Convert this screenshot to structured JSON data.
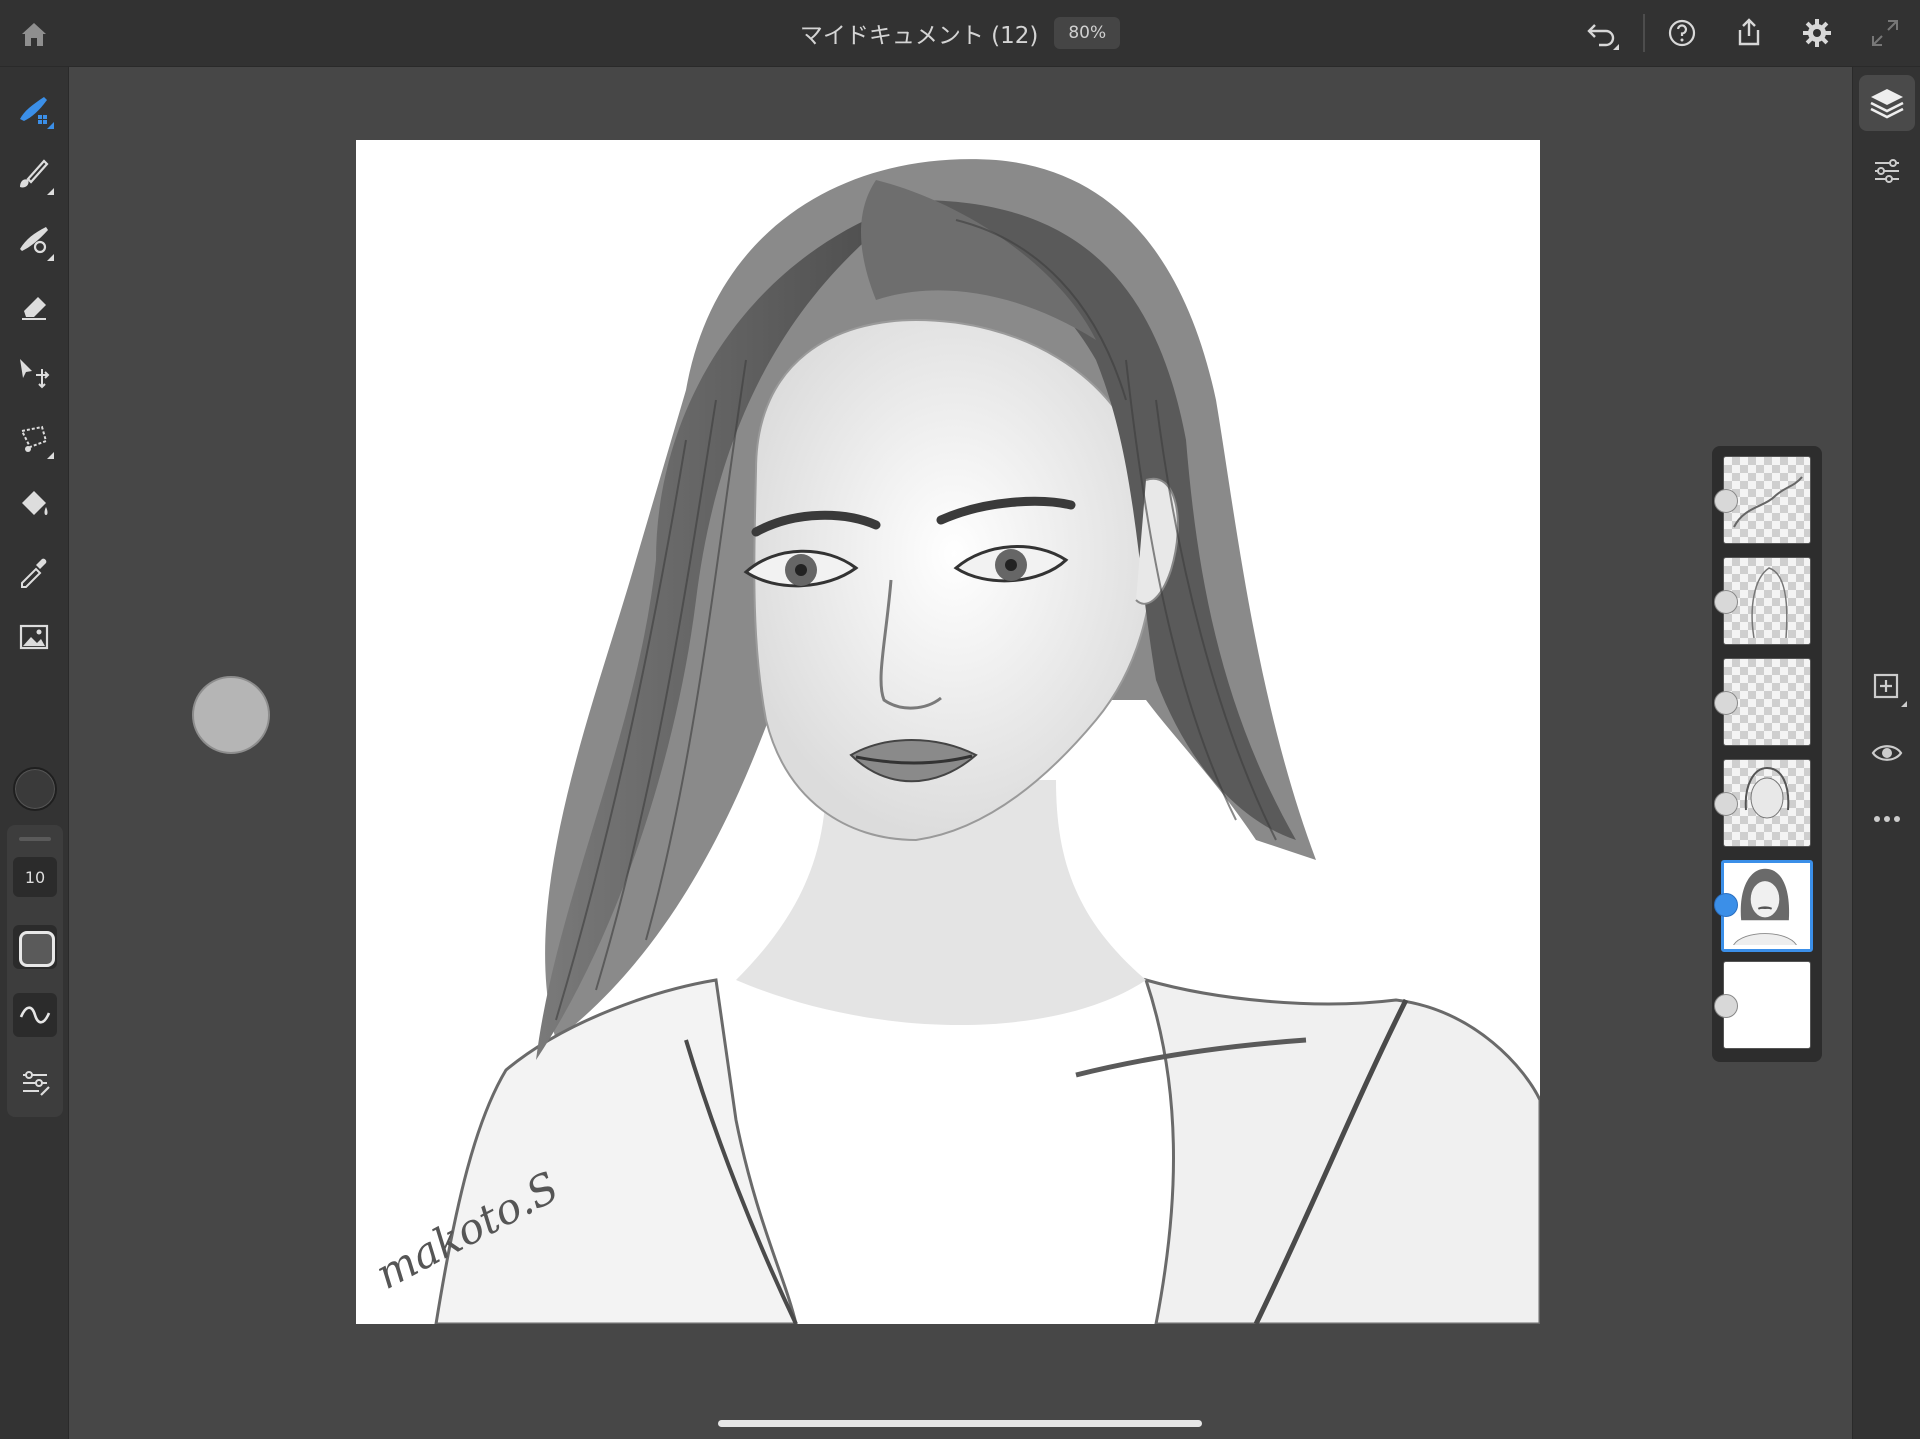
{
  "header": {
    "title": "マイドキュメント (12)",
    "zoom": "80%"
  },
  "toolbar": {
    "icons": [
      "home-icon",
      "undo-icon",
      "help-icon",
      "share-icon",
      "settings-icon",
      "fullscreen-icon"
    ]
  },
  "tools": {
    "items": [
      "pixel-brush",
      "live-brush",
      "vector-brush",
      "eraser",
      "transform",
      "lasso",
      "fill",
      "eyedropper",
      "place-image"
    ],
    "active": "pixel-brush",
    "brush_size": "10"
  },
  "canvas": {
    "signature": "makoto.S"
  },
  "layers": {
    "count": 6,
    "active_index": 4
  },
  "colors": {
    "accent": "#3b8fe8",
    "chrome": "#323232",
    "workspace": "#474747"
  }
}
